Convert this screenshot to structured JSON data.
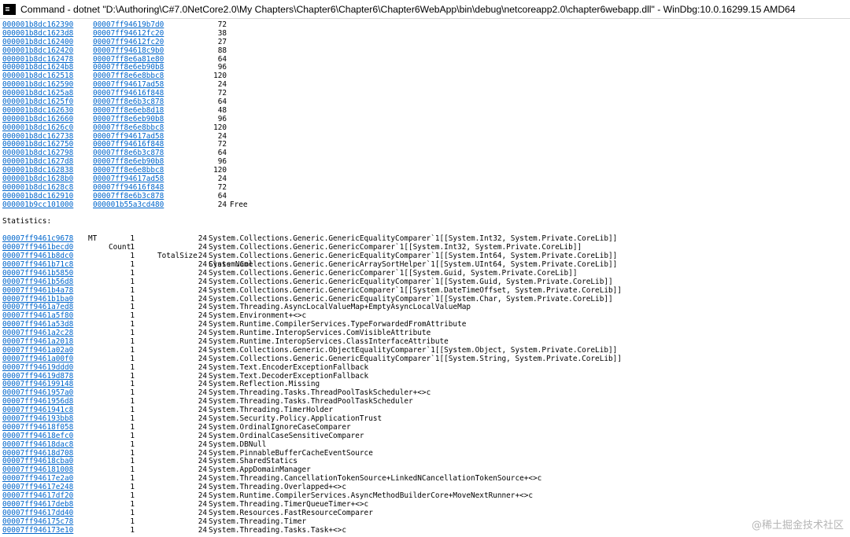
{
  "window": {
    "title": "Command - dotnet \"D:\\Authoring\\C#7.0NetCore2.0\\My Chapters\\Chapter6\\Chapter6\\Chapter6WebApp\\bin\\debug\\netcoreapp2.0\\chapter6webapp.dll\" - WinDbg:10.0.16299.15 AMD64"
  },
  "heap_objects": [
    {
      "address": "000001b8dc162390",
      "mt": "00007ff94619b7d0",
      "size": "72",
      "note": ""
    },
    {
      "address": "000001b8dc1623d8",
      "mt": "00007ff94612fc20",
      "size": "38",
      "note": ""
    },
    {
      "address": "000001b8dc162400",
      "mt": "00007ff94612fc20",
      "size": "27",
      "note": ""
    },
    {
      "address": "000001b8dc162420",
      "mt": "00007ff94618c9b0",
      "size": "88",
      "note": ""
    },
    {
      "address": "000001b8dc162478",
      "mt": "00007ff8e6a81e80",
      "size": "64",
      "note": ""
    },
    {
      "address": "000001b8dc1624b8",
      "mt": "00007ff8e6eb90b8",
      "size": "96",
      "note": ""
    },
    {
      "address": "000001b8dc162518",
      "mt": "00007ff8e6e8bbc8",
      "size": "120",
      "note": ""
    },
    {
      "address": "000001b8dc162590",
      "mt": "00007ff94617ad58",
      "size": "24",
      "note": ""
    },
    {
      "address": "000001b8dc1625a8",
      "mt": "00007ff94616f848",
      "size": "72",
      "note": ""
    },
    {
      "address": "000001b8dc1625f0",
      "mt": "00007ff8e6b3c878",
      "size": "64",
      "note": ""
    },
    {
      "address": "000001b8dc162630",
      "mt": "00007ff8e6eb8d18",
      "size": "48",
      "note": ""
    },
    {
      "address": "000001b8dc162660",
      "mt": "00007ff8e6eb90b8",
      "size": "96",
      "note": ""
    },
    {
      "address": "000001b8dc1626c0",
      "mt": "00007ff8e6e8bbc8",
      "size": "120",
      "note": ""
    },
    {
      "address": "000001b8dc162738",
      "mt": "00007ff94617ad58",
      "size": "24",
      "note": ""
    },
    {
      "address": "000001b8dc162750",
      "mt": "00007ff94616f848",
      "size": "72",
      "note": ""
    },
    {
      "address": "000001b8dc162798",
      "mt": "00007ff8e6b3c878",
      "size": "64",
      "note": ""
    },
    {
      "address": "000001b8dc1627d8",
      "mt": "00007ff8e6eb90b8",
      "size": "96",
      "note": ""
    },
    {
      "address": "000001b8dc162838",
      "mt": "00007ff8e6e8bbc8",
      "size": "120",
      "note": ""
    },
    {
      "address": "000001b8dc1628b0",
      "mt": "00007ff94617ad58",
      "size": "24",
      "note": ""
    },
    {
      "address": "000001b8dc1628c8",
      "mt": "00007ff94616f848",
      "size": "72",
      "note": ""
    },
    {
      "address": "000001b8dc162910",
      "mt": "00007ff8e6b3c878",
      "size": "64",
      "note": ""
    },
    {
      "address": "000001b9cc101000",
      "mt": "000001b55a3cd480",
      "size": "24",
      "note": "Free"
    }
  ],
  "statistics": {
    "label": "Statistics:",
    "headers": {
      "mt": "MT",
      "count": "Count",
      "total_size": "TotalSize",
      "class_name": "Class Name"
    },
    "rows": [
      {
        "mt": "00007ff9461c9678",
        "count": "1",
        "total_size": "24",
        "class_name": "System.Collections.Generic.GenericEqualityComparer`1[[System.Int32, System.Private.CoreLib]]"
      },
      {
        "mt": "00007ff9461becd0",
        "count": "1",
        "total_size": "24",
        "class_name": "System.Collections.Generic.GenericComparer`1[[System.Int32, System.Private.CoreLib]]"
      },
      {
        "mt": "00007ff9461b8dc0",
        "count": "1",
        "total_size": "24",
        "class_name": "System.Collections.Generic.GenericEqualityComparer`1[[System.Int64, System.Private.CoreLib]]"
      },
      {
        "mt": "00007ff9461b71c8",
        "count": "1",
        "total_size": "24",
        "class_name": "System.Collections.Generic.GenericArraySortHelper`1[[System.UInt64, System.Private.CoreLib]]"
      },
      {
        "mt": "00007ff9461b5850",
        "count": "1",
        "total_size": "24",
        "class_name": "System.Collections.Generic.GenericComparer`1[[System.Guid, System.Private.CoreLib]]"
      },
      {
        "mt": "00007ff9461b56d8",
        "count": "1",
        "total_size": "24",
        "class_name": "System.Collections.Generic.GenericEqualityComparer`1[[System.Guid, System.Private.CoreLib]]"
      },
      {
        "mt": "00007ff9461b4a78",
        "count": "1",
        "total_size": "24",
        "class_name": "System.Collections.Generic.GenericComparer`1[[System.DateTimeOffset, System.Private.CoreLib]]"
      },
      {
        "mt": "00007ff9461b1ba0",
        "count": "1",
        "total_size": "24",
        "class_name": "System.Collections.Generic.GenericEqualityComparer`1[[System.Char, System.Private.CoreLib]]"
      },
      {
        "mt": "00007ff9461a7ed8",
        "count": "1",
        "total_size": "24",
        "class_name": "System.Threading.AsyncLocalValueMap+EmptyAsyncLocalValueMap"
      },
      {
        "mt": "00007ff9461a5f80",
        "count": "1",
        "total_size": "24",
        "class_name": "System.Environment+<>c"
      },
      {
        "mt": "00007ff9461a53d8",
        "count": "1",
        "total_size": "24",
        "class_name": "System.Runtime.CompilerServices.TypeForwardedFromAttribute"
      },
      {
        "mt": "00007ff9461a2c28",
        "count": "1",
        "total_size": "24",
        "class_name": "System.Runtime.InteropServices.ComVisibleAttribute"
      },
      {
        "mt": "00007ff9461a2018",
        "count": "1",
        "total_size": "24",
        "class_name": "System.Runtime.InteropServices.ClassInterfaceAttribute"
      },
      {
        "mt": "00007ff9461a02a0",
        "count": "1",
        "total_size": "24",
        "class_name": "System.Collections.Generic.ObjectEqualityComparer`1[[System.Object, System.Private.CoreLib]]"
      },
      {
        "mt": "00007ff9461a00f0",
        "count": "1",
        "total_size": "24",
        "class_name": "System.Collections.Generic.GenericEqualityComparer`1[[System.String, System.Private.CoreLib]]"
      },
      {
        "mt": "00007ff94619ddd0",
        "count": "1",
        "total_size": "24",
        "class_name": "System.Text.EncoderExceptionFallback"
      },
      {
        "mt": "00007ff94619d878",
        "count": "1",
        "total_size": "24",
        "class_name": "System.Text.DecoderExceptionFallback"
      },
      {
        "mt": "00007ff946199148",
        "count": "1",
        "total_size": "24",
        "class_name": "System.Reflection.Missing"
      },
      {
        "mt": "00007ff9461957a0",
        "count": "1",
        "total_size": "24",
        "class_name": "System.Threading.Tasks.ThreadPoolTaskScheduler+<>c"
      },
      {
        "mt": "00007ff9461956d8",
        "count": "1",
        "total_size": "24",
        "class_name": "System.Threading.Tasks.ThreadPoolTaskScheduler"
      },
      {
        "mt": "00007ff9461941c8",
        "count": "1",
        "total_size": "24",
        "class_name": "System.Threading.TimerHolder"
      },
      {
        "mt": "00007ff946193bb8",
        "count": "1",
        "total_size": "24",
        "class_name": "System.Security.Policy.ApplicationTrust"
      },
      {
        "mt": "00007ff94618f058",
        "count": "1",
        "total_size": "24",
        "class_name": "System.OrdinalIgnoreCaseComparer"
      },
      {
        "mt": "00007ff94618efc0",
        "count": "1",
        "total_size": "24",
        "class_name": "System.OrdinalCaseSensitiveComparer"
      },
      {
        "mt": "00007ff94618dac8",
        "count": "1",
        "total_size": "24",
        "class_name": "System.DBNull"
      },
      {
        "mt": "00007ff94618d708",
        "count": "1",
        "total_size": "24",
        "class_name": "System.PinnableBufferCacheEventSource"
      },
      {
        "mt": "00007ff94618cba0",
        "count": "1",
        "total_size": "24",
        "class_name": "System.SharedStatics"
      },
      {
        "mt": "00007ff946181008",
        "count": "1",
        "total_size": "24",
        "class_name": "System.AppDomainManager"
      },
      {
        "mt": "00007ff94617e2a0",
        "count": "1",
        "total_size": "24",
        "class_name": "System.Threading.CancellationTokenSource+LinkedNCancellationTokenSource+<>c"
      },
      {
        "mt": "00007ff94617e248",
        "count": "1",
        "total_size": "24",
        "class_name": "System.Threading.Overlapped+<>c"
      },
      {
        "mt": "00007ff94617df20",
        "count": "1",
        "total_size": "24",
        "class_name": "System.Runtime.CompilerServices.AsyncMethodBuilderCore+MoveNextRunner+<>c"
      },
      {
        "mt": "00007ff94617deb8",
        "count": "1",
        "total_size": "24",
        "class_name": "System.Threading.TimerQueueTimer+<>c"
      },
      {
        "mt": "00007ff94617dd40",
        "count": "1",
        "total_size": "24",
        "class_name": "System.Resources.FastResourceComparer"
      },
      {
        "mt": "00007ff946175c78",
        "count": "1",
        "total_size": "24",
        "class_name": "System.Threading.Timer"
      },
      {
        "mt": "00007ff946173e10",
        "count": "1",
        "total_size": "24",
        "class_name": "System.Threading.Tasks.Task+<>c"
      }
    ]
  },
  "watermark": "@稀土掘金技术社区"
}
